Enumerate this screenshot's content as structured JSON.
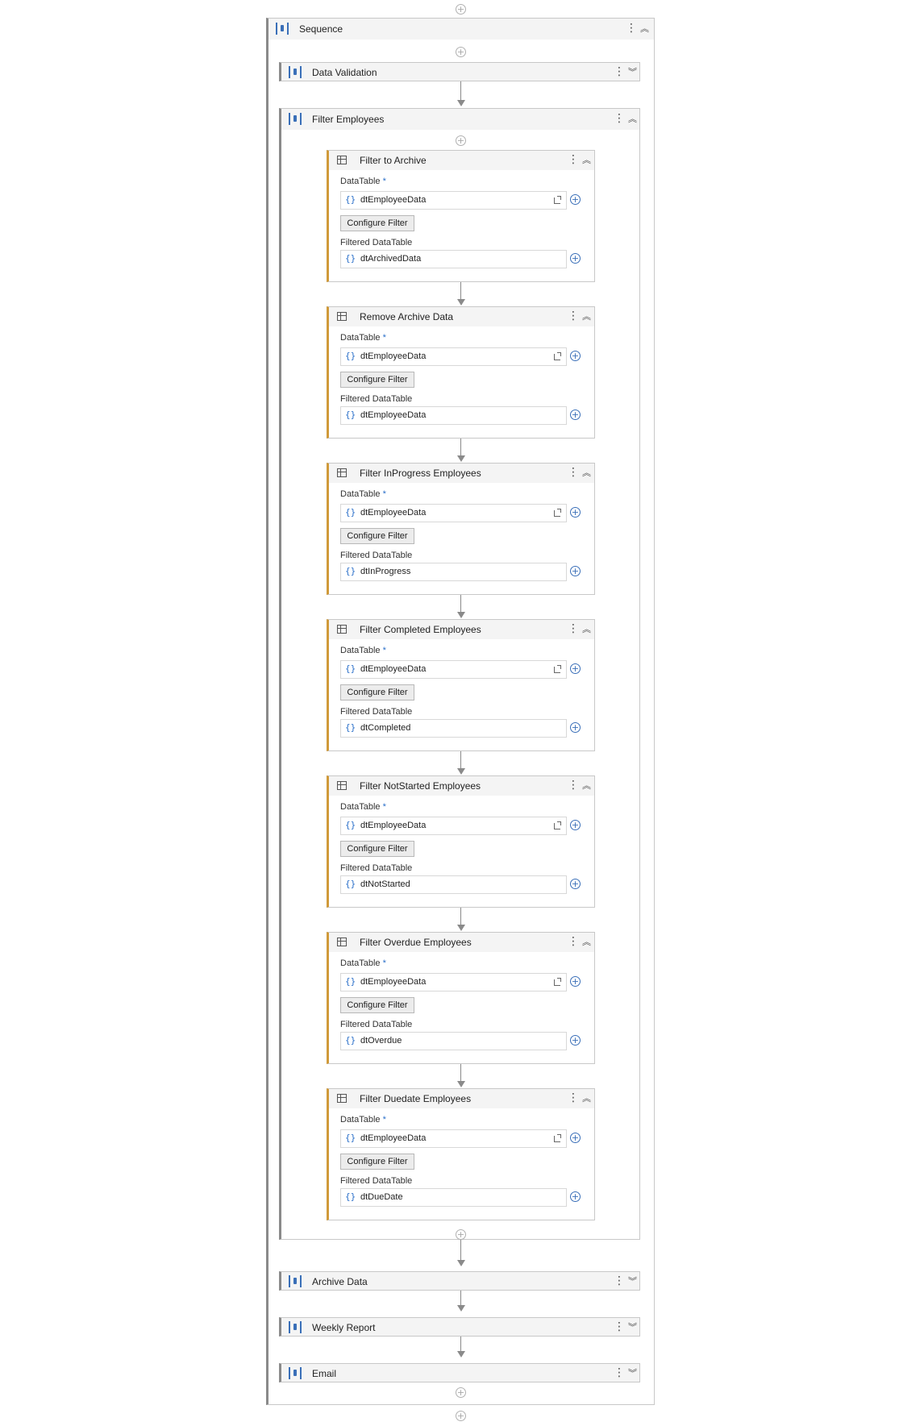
{
  "workflow": {
    "root": {
      "title": "Sequence"
    },
    "data_validation": {
      "title": "Data Validation"
    },
    "filter_employees": {
      "title": "Filter Employees"
    },
    "activities": [
      {
        "title": "Filter to Archive",
        "input_label": "DataTable",
        "required_mark": "*",
        "input_value": "dtEmployeeData",
        "button_label": "Configure Filter",
        "output_label": "Filtered DataTable",
        "output_value": "dtArchivedData"
      },
      {
        "title": "Remove Archive Data",
        "input_label": "DataTable",
        "required_mark": "*",
        "input_value": "dtEmployeeData",
        "button_label": "Configure Filter",
        "output_label": "Filtered DataTable",
        "output_value": "dtEmployeeData"
      },
      {
        "title": "Filter InProgress Employees",
        "input_label": "DataTable",
        "required_mark": "*",
        "input_value": "dtEmployeeData",
        "button_label": "Configure Filter",
        "output_label": "Filtered DataTable",
        "output_value": "dtInProgress"
      },
      {
        "title": "Filter Completed Employees",
        "input_label": "DataTable",
        "required_mark": "*",
        "input_value": "dtEmployeeData",
        "button_label": "Configure Filter",
        "output_label": "Filtered DataTable",
        "output_value": "dtCompleted"
      },
      {
        "title": "Filter NotStarted Employees",
        "input_label": "DataTable",
        "required_mark": "*",
        "input_value": "dtEmployeeData",
        "button_label": "Configure Filter",
        "output_label": "Filtered DataTable",
        "output_value": "dtNotStarted"
      },
      {
        "title": "Filter Overdue Employees",
        "input_label": "DataTable",
        "required_mark": "*",
        "input_value": "dtEmployeeData",
        "button_label": "Configure Filter",
        "output_label": "Filtered DataTable",
        "output_value": "dtOverdue"
      },
      {
        "title": "Filter Duedate Employees",
        "input_label": "DataTable",
        "required_mark": "*",
        "input_value": "dtEmployeeData",
        "button_label": "Configure Filter",
        "output_label": "Filtered DataTable",
        "output_value": "dtDueDate"
      }
    ],
    "archive_data": {
      "title": "Archive Data"
    },
    "weekly_report": {
      "title": "Weekly Report"
    },
    "email": {
      "title": "Email"
    }
  },
  "icons": {
    "add": "plus-circle-icon",
    "sequence": "sequence-icon",
    "filter_table": "filter-data-table-icon",
    "more": "vertical-ellipsis-icon",
    "collapse": "chevron-double-up-icon",
    "expand": "chevron-double-down-icon",
    "expression": "curly-braces-icon",
    "open_editor": "expand-editor-icon"
  },
  "colors": {
    "accent_blue": "#2a6fc9",
    "activity_accent": "#d09a3a",
    "header_bg": "#f4f4f4",
    "connector": "#8a8a8a"
  }
}
